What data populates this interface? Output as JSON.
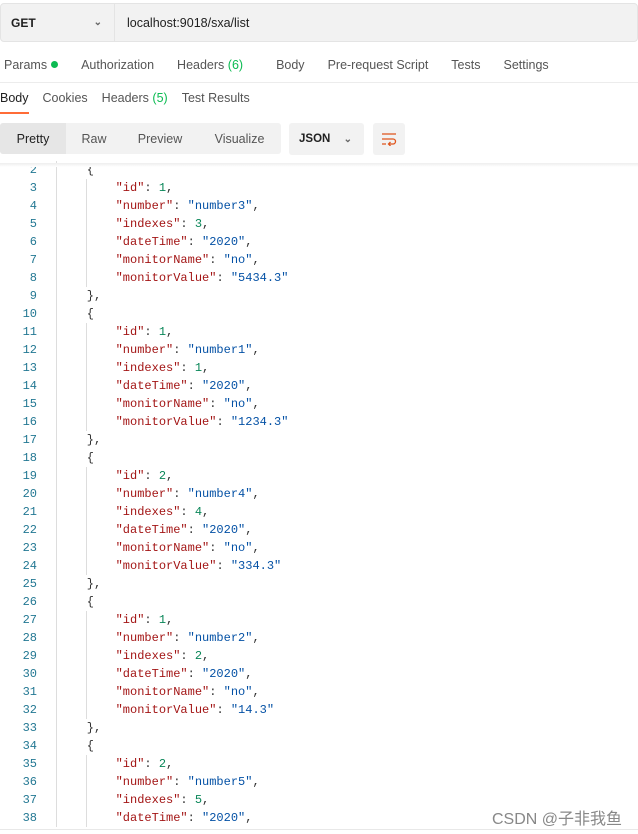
{
  "request": {
    "method": "GET",
    "url": "localhost:9018/sxa/list"
  },
  "request_tabs": [
    {
      "label": "Params"
    },
    {
      "label": "Authorization"
    },
    {
      "label": "Headers",
      "count": "(6)"
    },
    {
      "label": "Body"
    },
    {
      "label": "Pre-request Script"
    },
    {
      "label": "Tests"
    },
    {
      "label": "Settings"
    }
  ],
  "response_tabs": [
    {
      "label": "Body"
    },
    {
      "label": "Cookies"
    },
    {
      "label": "Headers",
      "count": "(5)"
    },
    {
      "label": "Test Results"
    }
  ],
  "view_modes": [
    "Pretty",
    "Raw",
    "Preview",
    "Visualize"
  ],
  "format": "JSON",
  "accent": "#ff6c37",
  "code": {
    "first_line": 2,
    "objects": [
      [
        [
          "id",
          1
        ],
        [
          "number",
          "number3"
        ],
        [
          "indexes",
          3
        ],
        [
          "dateTime",
          "2020"
        ],
        [
          "monitorName",
          "no"
        ],
        [
          "monitorValue",
          "5434.3"
        ]
      ],
      [
        [
          "id",
          1
        ],
        [
          "number",
          "number1"
        ],
        [
          "indexes",
          1
        ],
        [
          "dateTime",
          "2020"
        ],
        [
          "monitorName",
          "no"
        ],
        [
          "monitorValue",
          "1234.3"
        ]
      ],
      [
        [
          "id",
          2
        ],
        [
          "number",
          "number4"
        ],
        [
          "indexes",
          4
        ],
        [
          "dateTime",
          "2020"
        ],
        [
          "monitorName",
          "no"
        ],
        [
          "monitorValue",
          "334.3"
        ]
      ],
      [
        [
          "id",
          1
        ],
        [
          "number",
          "number2"
        ],
        [
          "indexes",
          2
        ],
        [
          "dateTime",
          "2020"
        ],
        [
          "monitorName",
          "no"
        ],
        [
          "monitorValue",
          "14.3"
        ]
      ],
      [
        [
          "id",
          2
        ],
        [
          "number",
          "number5"
        ],
        [
          "indexes",
          5
        ],
        [
          "dateTime",
          "2020"
        ]
      ]
    ]
  },
  "watermark": "CSDN @子非我鱼"
}
